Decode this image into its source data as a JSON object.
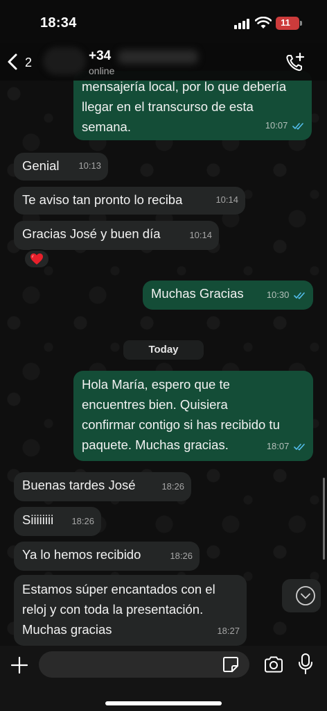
{
  "status_bar": {
    "time": "18:34",
    "battery": "11"
  },
  "header": {
    "back_count": "2",
    "contact_name": "+34",
    "contact_status": "online"
  },
  "messages": [
    {
      "dir": "out",
      "lines": [
        "mensajería local, por lo que debería",
        "llegar en el transcurso de esta",
        "semana."
      ],
      "time": "10:07",
      "read": true
    },
    {
      "dir": "in",
      "lines": [
        "Genial"
      ],
      "time": "10:13"
    },
    {
      "dir": "in",
      "lines": [
        "Te aviso tan pronto lo reciba"
      ],
      "time": "10:14"
    },
    {
      "dir": "in",
      "lines": [
        "Gracias José y buen día"
      ],
      "time": "10:14",
      "reaction": "❤️"
    },
    {
      "dir": "out",
      "lines": [
        "Muchas Gracias"
      ],
      "time": "10:30",
      "read": true
    },
    {
      "dir": "out",
      "lines": [
        "Hola María, espero que te",
        "encuentres bien. Quisiera",
        "confirmar contigo si has recibido tu",
        "paquete. Muchas gracias."
      ],
      "time": "18:07",
      "read": true
    },
    {
      "dir": "in",
      "lines": [
        "Buenas tardes José"
      ],
      "time": "18:26"
    },
    {
      "dir": "in",
      "lines": [
        "Siiiiiiii"
      ],
      "time": "18:26"
    },
    {
      "dir": "in",
      "lines": [
        "Ya lo hemos recibido"
      ],
      "time": "18:26"
    },
    {
      "dir": "in",
      "lines": [
        "Estamos súper encantados con el",
        "reloj y con toda la presentación.",
        "Muchas gracias"
      ],
      "time": "18:27"
    }
  ],
  "date_separator": "Today",
  "input": {
    "placeholder": "",
    "value": ""
  },
  "colors": {
    "incoming_bubble": "#242626",
    "outgoing_bubble": "#144d37",
    "read_ticks": "#53bdeb",
    "battery": "#cc3b3b"
  },
  "icons": [
    "back-icon",
    "add-call-icon",
    "plus-icon",
    "sticker-icon",
    "camera-icon",
    "mic-icon",
    "chevron-down-icon",
    "signal-icon",
    "wifi-icon",
    "battery-icon"
  ]
}
